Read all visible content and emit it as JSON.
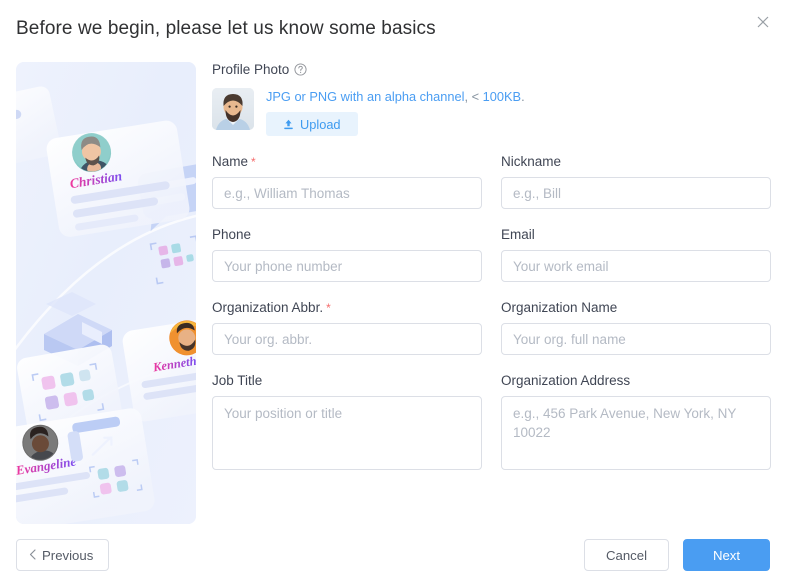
{
  "dialog": {
    "title": "Before we begin, please let us know some basics",
    "close_label": "×"
  },
  "illustration": {
    "names": [
      "Christian",
      "Kenneth",
      "Evangeline"
    ]
  },
  "profile_photo": {
    "label": "Profile Photo",
    "help_icon": "question-circle-icon",
    "hint_link_1": "JPG or PNG with an alpha channel",
    "hint_sep_1": ", ",
    "hint_lt": "< ",
    "hint_link_2": "100KB",
    "hint_end": ".",
    "upload_label": "Upload",
    "upload_icon": "upload-icon"
  },
  "fields": {
    "name": {
      "label": "Name",
      "required": "*",
      "placeholder": "e.g., William Thomas",
      "value": ""
    },
    "nickname": {
      "label": "Nickname",
      "placeholder": "e.g., Bill",
      "value": ""
    },
    "phone": {
      "label": "Phone",
      "placeholder": "Your phone number",
      "value": ""
    },
    "email": {
      "label": "Email",
      "placeholder": "Your work email",
      "value": ""
    },
    "org_abbr": {
      "label": "Organization Abbr.",
      "required": "*",
      "placeholder": "Your org. abbr.",
      "value": ""
    },
    "org_name": {
      "label": "Organization Name",
      "placeholder": "Your org. full name",
      "value": ""
    },
    "job_title": {
      "label": "Job Title",
      "placeholder": "Your position or title",
      "value": ""
    },
    "org_address": {
      "label": "Organization Address",
      "placeholder": "e.g., 456 Park Avenue, New York, NY 10022",
      "value": ""
    }
  },
  "footer": {
    "previous_label": "Previous",
    "previous_icon": "chevron-left-icon",
    "cancel_label": "Cancel",
    "next_label": "Next"
  },
  "colors": {
    "accent": "#4a9df2",
    "required": "#f56c6c",
    "upload_bg": "#e8f3fd",
    "border": "#dcdfe6",
    "text": "#303133",
    "placeholder": "#b4bac4"
  }
}
